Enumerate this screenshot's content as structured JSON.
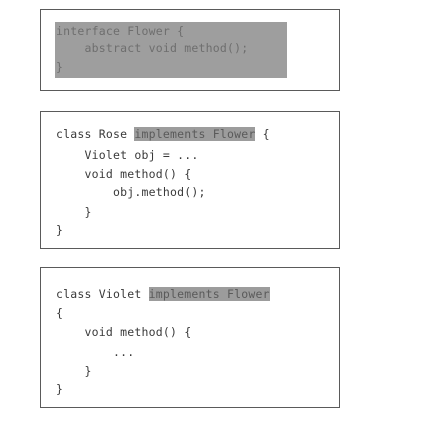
{
  "flower": {
    "line1": "interface Flower {",
    "line2": "    abstract void method();",
    "line3": "}"
  },
  "rose": {
    "class_kw": "class Rose ",
    "implements": "implements Flower",
    "brace_open": " {",
    "line2": "    Violet obj = ...",
    "line3": "    void method() {",
    "line4": "        obj.method();",
    "line5": "    }",
    "line6": "}"
  },
  "violet": {
    "class_kw": "class Violet ",
    "implements": "implements Flower",
    "line2": "{",
    "line3": "    void method() {",
    "line4": "        ...",
    "line5": "    }",
    "line6": "}"
  }
}
